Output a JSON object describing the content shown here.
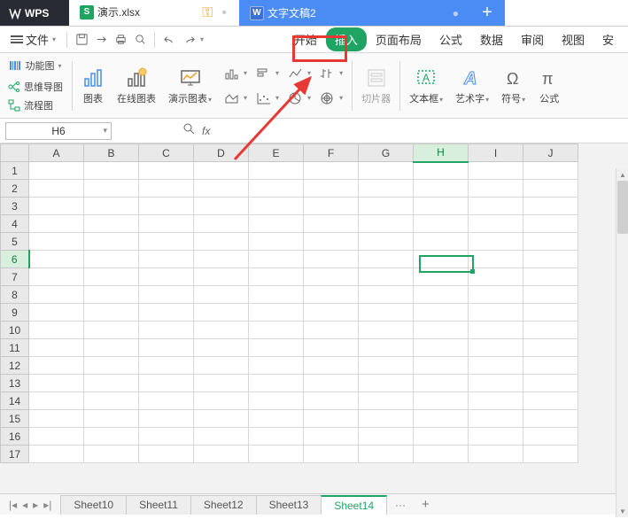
{
  "title_bar": {
    "app_name": "WPS",
    "tabs": [
      {
        "label": "演示.xlsx",
        "icon": "S"
      },
      {
        "label": "文字文稿2",
        "icon": "W"
      }
    ]
  },
  "menu_bar": {
    "file_label": "文件",
    "tabs": [
      "开始",
      "插入",
      "页面布局",
      "公式",
      "数据",
      "审阅",
      "视图",
      "安"
    ]
  },
  "ribbon": {
    "items": {
      "func_chart": "功能图",
      "mindmap": "思维导图",
      "flowchart": "流程图",
      "chart": "图表",
      "online_chart": "在线图表",
      "demo_chart": "演示图表",
      "slicer": "切片器",
      "textbox": "文本框",
      "artword": "艺术字",
      "symbol": "符号",
      "formula": "公式"
    }
  },
  "name_box": {
    "value": "H6"
  },
  "formula_bar": {
    "fx": "fx"
  },
  "grid": {
    "columns": [
      "A",
      "B",
      "C",
      "D",
      "E",
      "F",
      "G",
      "H",
      "I",
      "J"
    ],
    "rows": [
      "1",
      "2",
      "3",
      "4",
      "5",
      "6",
      "7",
      "8",
      "9",
      "10",
      "11",
      "12",
      "13",
      "14",
      "15",
      "16",
      "17"
    ],
    "selected_col": "H",
    "selected_row": "6"
  },
  "sheet_bar": {
    "tabs": [
      "Sheet10",
      "Sheet11",
      "Sheet12",
      "Sheet13",
      "Sheet14"
    ],
    "active": "Sheet14",
    "more": "···"
  }
}
